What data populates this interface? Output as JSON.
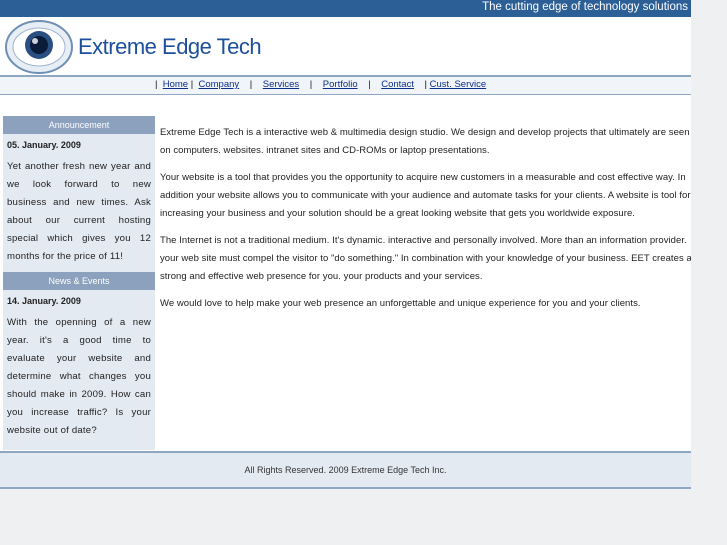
{
  "topbar": {
    "tagline": "The cutting edge of technology solutions"
  },
  "header": {
    "brand": "Extreme Edge Tech"
  },
  "nav": {
    "items": [
      "Home",
      "Company",
      "Services",
      "Portfolio",
      "Contact",
      "Cust. Service"
    ]
  },
  "sidebar": {
    "announcement": {
      "heading": "Announcement",
      "date": "05. January. 2009",
      "text": "Yet another fresh new year and we look forward to new business and new times. Ask about our current hosting special which gives you 12 months for the price of 11!"
    },
    "news": {
      "heading": "News & Events",
      "date": "14. January. 2009",
      "text": "With the openning of a new year. it's a good time to evaluate your website and determine what changes you should make in 2009. How can you increase traffic? Is your website out of date?"
    }
  },
  "content": {
    "paragraphs": [
      "Extreme Edge Tech is a interactive web & multimedia design studio. We design and develop projects that ultimately are seen on computers. websites. intranet sites and CD-ROMs or laptop presentations.",
      "Your website is a tool that provides you the opportunity to acquire new customers in a measurable and cost effective way. In addition your website allows you to communicate with your audience and automate tasks for your clients. A website is tool for increasing your business and your solution should be a great looking website that gets you worldwide exposure.",
      "The Internet is not a traditional medium. It's dynamic. interactive and personally involved. More than an information provider. your web site must compel the visitor to \"do something.\" In combination with your knowledge of your business. EET creates a strong and effective web presence for you. your products and your services.",
      "We would love to help make your web presence an unforgettable and unique experience for you and your clients."
    ]
  },
  "footer": {
    "text": "All Rights Reserved. 2009 Extreme Edge Tech Inc."
  },
  "colors": {
    "topbar": "#2c5f96",
    "brand": "#1d4f9a",
    "sidebar_head": "#8ba1bd",
    "sidebar_bg": "#e4eaf2"
  }
}
